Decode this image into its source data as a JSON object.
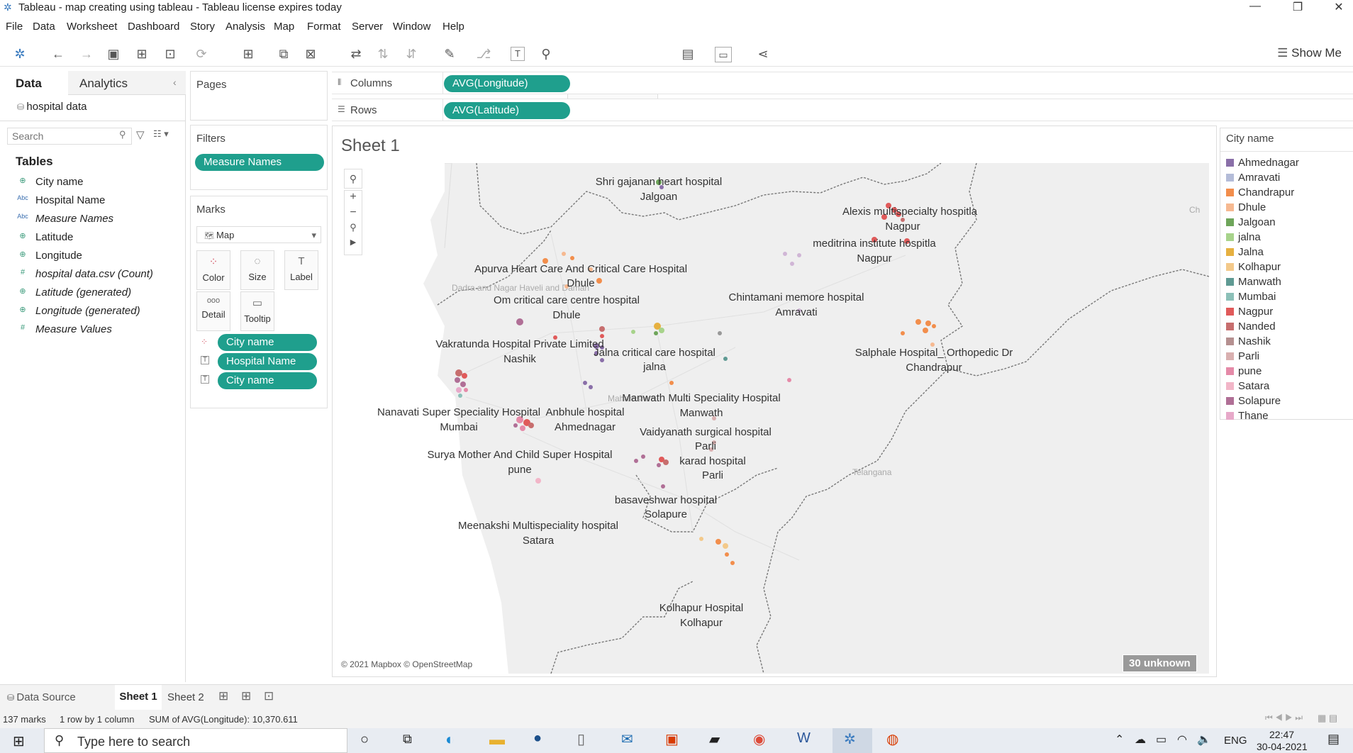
{
  "window": {
    "title": "Tableau - map creating using tableau - Tableau license expires today"
  },
  "menu": [
    "File",
    "Data",
    "Worksheet",
    "Dashboard",
    "Story",
    "Analysis",
    "Map",
    "Format",
    "Server",
    "Window",
    "Help"
  ],
  "toolbar": {
    "show_me": "Show Me"
  },
  "data_pane": {
    "tab_data": "Data",
    "tab_analytics": "Analytics",
    "datasource": "hospital data",
    "search_placeholder": "Search",
    "tables_heading": "Tables",
    "fields": [
      {
        "icon": "globe-icon",
        "type": "⊕",
        "name": "City name"
      },
      {
        "icon": "abc-icon",
        "type": "Abc",
        "name": "Hospital Name"
      },
      {
        "icon": "abc-icon",
        "type": "Abc",
        "name": "Measure Names"
      },
      {
        "icon": "globe-icon",
        "type": "⊕",
        "name": "Latitude"
      },
      {
        "icon": "globe-icon",
        "type": "⊕",
        "name": "Longitude"
      },
      {
        "icon": "hash-icon",
        "type": "#",
        "name": "hospital data.csv (Count)"
      },
      {
        "icon": "globe-icon",
        "type": "⊕",
        "name": "Latitude (generated)"
      },
      {
        "icon": "globe-icon",
        "type": "⊕",
        "name": "Longitude (generated)"
      },
      {
        "icon": "hash-icon",
        "type": "#",
        "name": "Measure Values"
      }
    ]
  },
  "pages": {
    "title": "Pages"
  },
  "filters": {
    "title": "Filters",
    "pills": [
      "Measure Names"
    ]
  },
  "marks": {
    "title": "Marks",
    "type": "Map",
    "buttons": [
      {
        "icon": "color-icon",
        "glyph": "⁘",
        "label": "Color"
      },
      {
        "icon": "size-icon",
        "glyph": "◌",
        "label": "Size"
      },
      {
        "icon": "label-icon",
        "glyph": "T",
        "label": "Label"
      },
      {
        "icon": "detail-icon",
        "glyph": "ooo",
        "label": "Detail"
      },
      {
        "icon": "tooltip-icon",
        "glyph": "▭",
        "label": "Tooltip"
      }
    ],
    "pills": [
      "City name",
      "Hospital Name",
      "City name"
    ]
  },
  "shelves": {
    "columns_label": "Columns",
    "columns_pill": "AVG(Longitude)",
    "rows_label": "Rows",
    "rows_pill": "AVG(Latitude)"
  },
  "sheet": {
    "title": "Sheet 1",
    "attribution": "© 2021 Mapbox © OpenStreetMap",
    "unknown": "30 unknown",
    "map_regions": [
      "Dadra and Nagar Haveli and Daman",
      "Maharashtra",
      "Telangana",
      "Ch"
    ],
    "labels": [
      {
        "name": "Shri gajanan heart hospital",
        "city": "Jalgoan"
      },
      {
        "name": "Alexis multispecialty hospitla",
        "city": "Nagpur"
      },
      {
        "name": "meditrina institute hospitla",
        "city": "Nagpur"
      },
      {
        "name": "Apurva Heart Care And Critical Care Hospital",
        "city": "Dhule"
      },
      {
        "name": "Om critical care centre hospital",
        "city": "Dhule"
      },
      {
        "name": "Chintamani  memore hospital",
        "city": "Amravati"
      },
      {
        "name": "Vakratunda Hospital Private Limited",
        "city": "Nashik"
      },
      {
        "name": "Jalna critical care hospital",
        "city": "jalna"
      },
      {
        "name": "Salphale Hospital_ Orthopedic Dr",
        "city": "Chandrapur"
      },
      {
        "name": "Manwath Multi Speciality Hospital",
        "city": "Manwath"
      },
      {
        "name": "Nanavati Super Speciality Hospital",
        "city": "Mumbai"
      },
      {
        "name": "Anbhule hospital",
        "city": "Ahmednagar"
      },
      {
        "name": "Vaidyanath surgical hospital",
        "city": "Parli"
      },
      {
        "name": "Surya Mother And Child Super Hospital",
        "city": "pune"
      },
      {
        "name": "karad hospital",
        "city": "Parli"
      },
      {
        "name": "basaveshwar hospital",
        "city": "Solapure"
      },
      {
        "name": "Meenakshi Multispeciality hospital",
        "city": "Satara"
      },
      {
        "name": "Kolhapur Hospital",
        "city": "Kolhapur"
      }
    ]
  },
  "legend": {
    "title": "City name",
    "items": [
      {
        "name": "Ahmednagar",
        "color": "#8a6fa8"
      },
      {
        "name": "Amravati",
        "color": "#b4bcd8"
      },
      {
        "name": "Chandrapur",
        "color": "#f28e4c"
      },
      {
        "name": "Dhule",
        "color": "#f6b991"
      },
      {
        "name": "Jalgoan",
        "color": "#6ea55a"
      },
      {
        "name": "jalna",
        "color": "#a7d38b"
      },
      {
        "name": "Jalna",
        "color": "#e6b040"
      },
      {
        "name": "Kolhapur",
        "color": "#f3c98a"
      },
      {
        "name": "Manwath",
        "color": "#5f9a93"
      },
      {
        "name": "Mumbai",
        "color": "#8cc0b8"
      },
      {
        "name": "Nagpur",
        "color": "#e05a5a"
      },
      {
        "name": "Nanded",
        "color": "#c76e6e"
      },
      {
        "name": "Nashik",
        "color": "#b59090"
      },
      {
        "name": "Parli",
        "color": "#d9b0b0"
      },
      {
        "name": "pune",
        "color": "#e58aa8"
      },
      {
        "name": "Satara",
        "color": "#f2b6c8"
      },
      {
        "name": "Solapure",
        "color": "#b06f96"
      },
      {
        "name": "Thane",
        "color": "#e7a9c9"
      }
    ]
  },
  "sheet_tabs": {
    "data_source": "Data Source",
    "tabs": [
      "Sheet 1",
      "Sheet 2"
    ]
  },
  "status": {
    "marks": "137 marks",
    "dims": "1 row by 1 column",
    "sum": "SUM of AVG(Longitude): 10,370.611"
  },
  "taskbar": {
    "search_placeholder": "Type here to search",
    "lang": "ENG",
    "time": "22:47",
    "date": "30-04-2021"
  }
}
